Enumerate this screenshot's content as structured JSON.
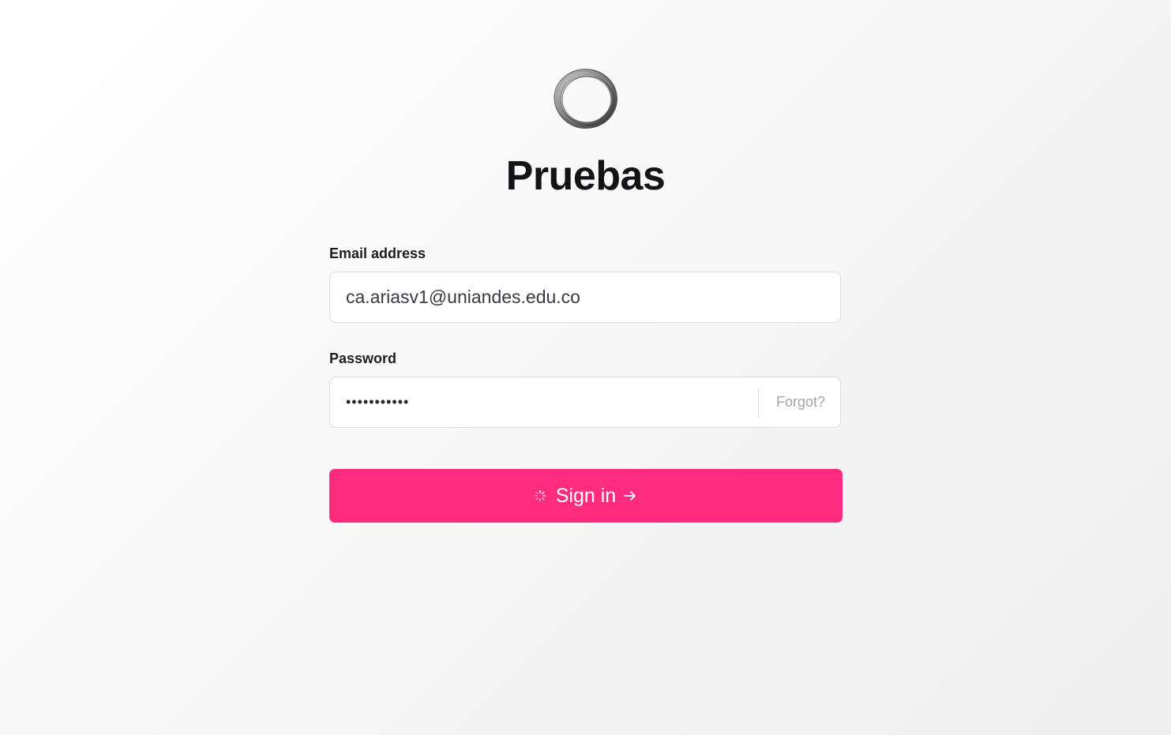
{
  "app": {
    "title": "Pruebas",
    "logo_icon": "ring-logo-icon"
  },
  "form": {
    "email_label": "Email address",
    "email_value": "ca.ariasv1@uniandes.edu.co",
    "password_label": "Password",
    "password_masked": "•••••••••••",
    "forgot_label": "Forgot?",
    "submit_label": "Sign in",
    "submit_state": "loading"
  },
  "colors": {
    "accent": "#fe2b7e",
    "text": "#141417",
    "muted": "#a4a4aa"
  }
}
